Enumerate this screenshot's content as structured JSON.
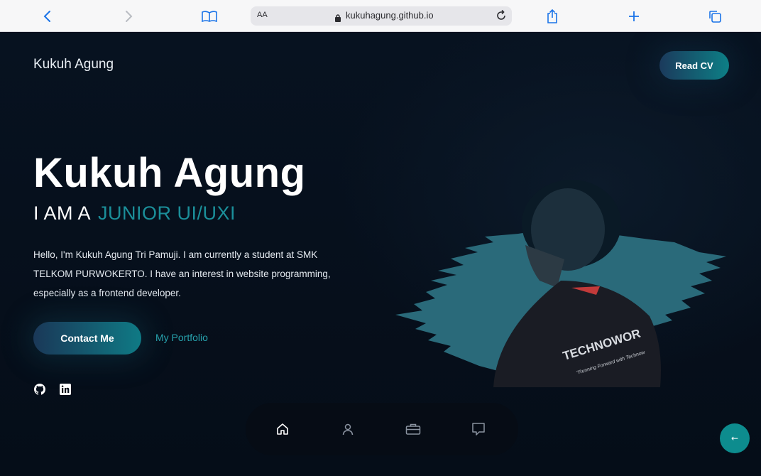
{
  "browser": {
    "text_size_label": "AA",
    "url_host": "kukuhagung.github.io"
  },
  "header": {
    "brand": "Kukuh Agung",
    "read_cv_label": "Read CV"
  },
  "hero": {
    "name": "Kukuh Agung",
    "subtitle_prefix": "I AM A",
    "subtitle_accent": "JUNIOR UI/UXI",
    "description": "Hello, I'm Kukuh Agung Tri Pamuji. I am currently a student at SMK TELKOM PURWOKERTO. I have an interest in website programming, especially as a frontend developer.",
    "contact_label": "Contact Me",
    "portfolio_label": "My Portfolio",
    "shirt_text_1": "TECHNOWOR",
    "shirt_text_2": "\"Running Forward with Technow"
  },
  "scroll_top_label": "←",
  "colors": {
    "accent": "#1b8f9a",
    "background": "#050d18",
    "splash": "#2a6a7a"
  },
  "icons": {
    "social": [
      "github-icon",
      "linkedin-icon"
    ],
    "nav": [
      "home-icon",
      "user-icon",
      "briefcase-icon",
      "message-icon"
    ]
  }
}
